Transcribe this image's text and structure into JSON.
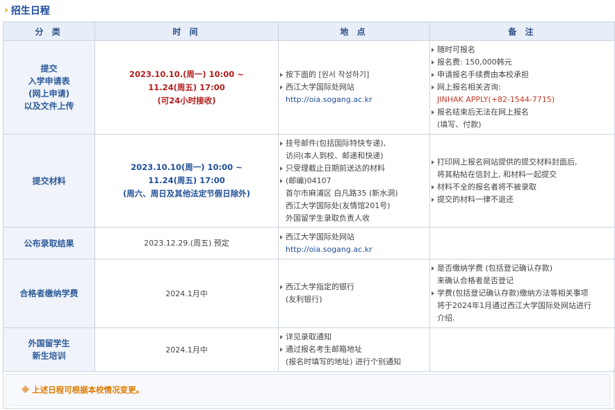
{
  "section": {
    "title": "招生日程"
  },
  "table": {
    "headers": [
      "分 类",
      "时 间",
      "地 点",
      "备 注"
    ],
    "rows": [
      {
        "category": [
          "提交",
          "入学申请表",
          "(网上申请)",
          "以及文件上传"
        ],
        "time": [
          "2023.10.10.(周一) 10:00 ~",
          "11.24(周五) 17:00",
          "(可24小时接收)"
        ],
        "place": [
          {
            "text": "按下面的 [원서 작성하기]",
            "bullet": true
          },
          {
            "text": "西江大学国际处网站",
            "bullet": true
          },
          {
            "text": "http://oia.sogang.ac.kr",
            "bullet": false,
            "url": true
          }
        ],
        "notes": [
          {
            "text": "随时可报名",
            "bullet": true
          },
          {
            "text": "报名费: 150,000韩元",
            "bullet": true
          },
          {
            "text": "申请报名手续费由本校承担",
            "bullet": true
          },
          {
            "text": "网上报名相关咨询:",
            "bullet": true
          },
          {
            "text": "JINHAK APPLY(+82-1544-7715)",
            "bullet": false,
            "red": true
          },
          {
            "text": "报名结束后无法在网上报名",
            "bullet": true
          },
          {
            "text": "(填写、付款)",
            "bullet": false
          }
        ]
      },
      {
        "category": [
          "提交材料"
        ],
        "time": [
          "2023.10.10(周一) 10:00 ~",
          "11.24(周五) 17:00",
          "(周六、周日及其他法定节假日除外)"
        ],
        "place": [
          {
            "text": "挂号邮件(包括国际特快专递),",
            "bullet": true
          },
          {
            "text": "访问(本人到校、邮递和快递)",
            "bullet": false
          },
          {
            "text": "只受理截止日期前送达的材料",
            "bullet": true
          },
          {
            "text": "(邮编)04107",
            "bullet": true
          },
          {
            "text": "首尔市麻浦区 白凡路35 (新水洞)",
            "bullet": false
          },
          {
            "text": "西江大学国际处(友情馆201号)",
            "bullet": false
          },
          {
            "text": "外国留学生录取负责人收",
            "bullet": false
          }
        ],
        "notes": [
          {
            "text": "打印网上报名网站提供的提交材料封面后,",
            "bullet": true
          },
          {
            "text": "将其粘帖在信封上, 和材料一起提交",
            "bullet": false
          },
          {
            "text": "材料不全的报名者将不被录取",
            "bullet": true
          },
          {
            "text": "提交的材料一律不退还",
            "bullet": true
          }
        ]
      },
      {
        "category": [
          "公布录取结果"
        ],
        "time": [
          "2023.12.29.(周五) 预定"
        ],
        "place": [
          {
            "text": "西江大学国际处网站",
            "bullet": true
          },
          {
            "text": "http://oia.sogang.ac.kr",
            "bullet": false,
            "url": true
          }
        ],
        "notes": []
      },
      {
        "category": [
          "合格者缴纳学费"
        ],
        "time": [
          "2024.1月中"
        ],
        "place": [
          {
            "text": "西江大学指定的银行",
            "bullet": true
          },
          {
            "text": "(友利银行)",
            "bullet": false
          }
        ],
        "notes": [
          {
            "text": "是否缴纳学费 (包括登记确认存款)",
            "bullet": true
          },
          {
            "text": "来确认合格者是否登记",
            "bullet": false
          },
          {
            "text": "学费(包括登记确认存款)缴纳方法等相关事项",
            "bullet": true
          },
          {
            "text": "将于2024年1月通过西江大学国际处网站进行",
            "bullet": false
          },
          {
            "text": "介绍.",
            "bullet": false
          }
        ]
      },
      {
        "category": [
          "外国留学生",
          "新生培训"
        ],
        "time": [
          "2024.1月中"
        ],
        "place": [
          {
            "text": "详见录取通知",
            "bullet": true
          },
          {
            "text": "通过报名考生邮箱地址",
            "bullet": true
          },
          {
            "text": "(报名时填写的地址) 进行个别通知",
            "bullet": false
          }
        ],
        "notes": []
      }
    ]
  },
  "footnote": "※ 上述日程可根据本校情况变更。",
  "colors": {
    "accent": "#e8a000",
    "title": "#1a4a9a",
    "header_bg": "#e7eef8",
    "red_time": "#b31d1d",
    "blue_time": "#1f4f99"
  }
}
